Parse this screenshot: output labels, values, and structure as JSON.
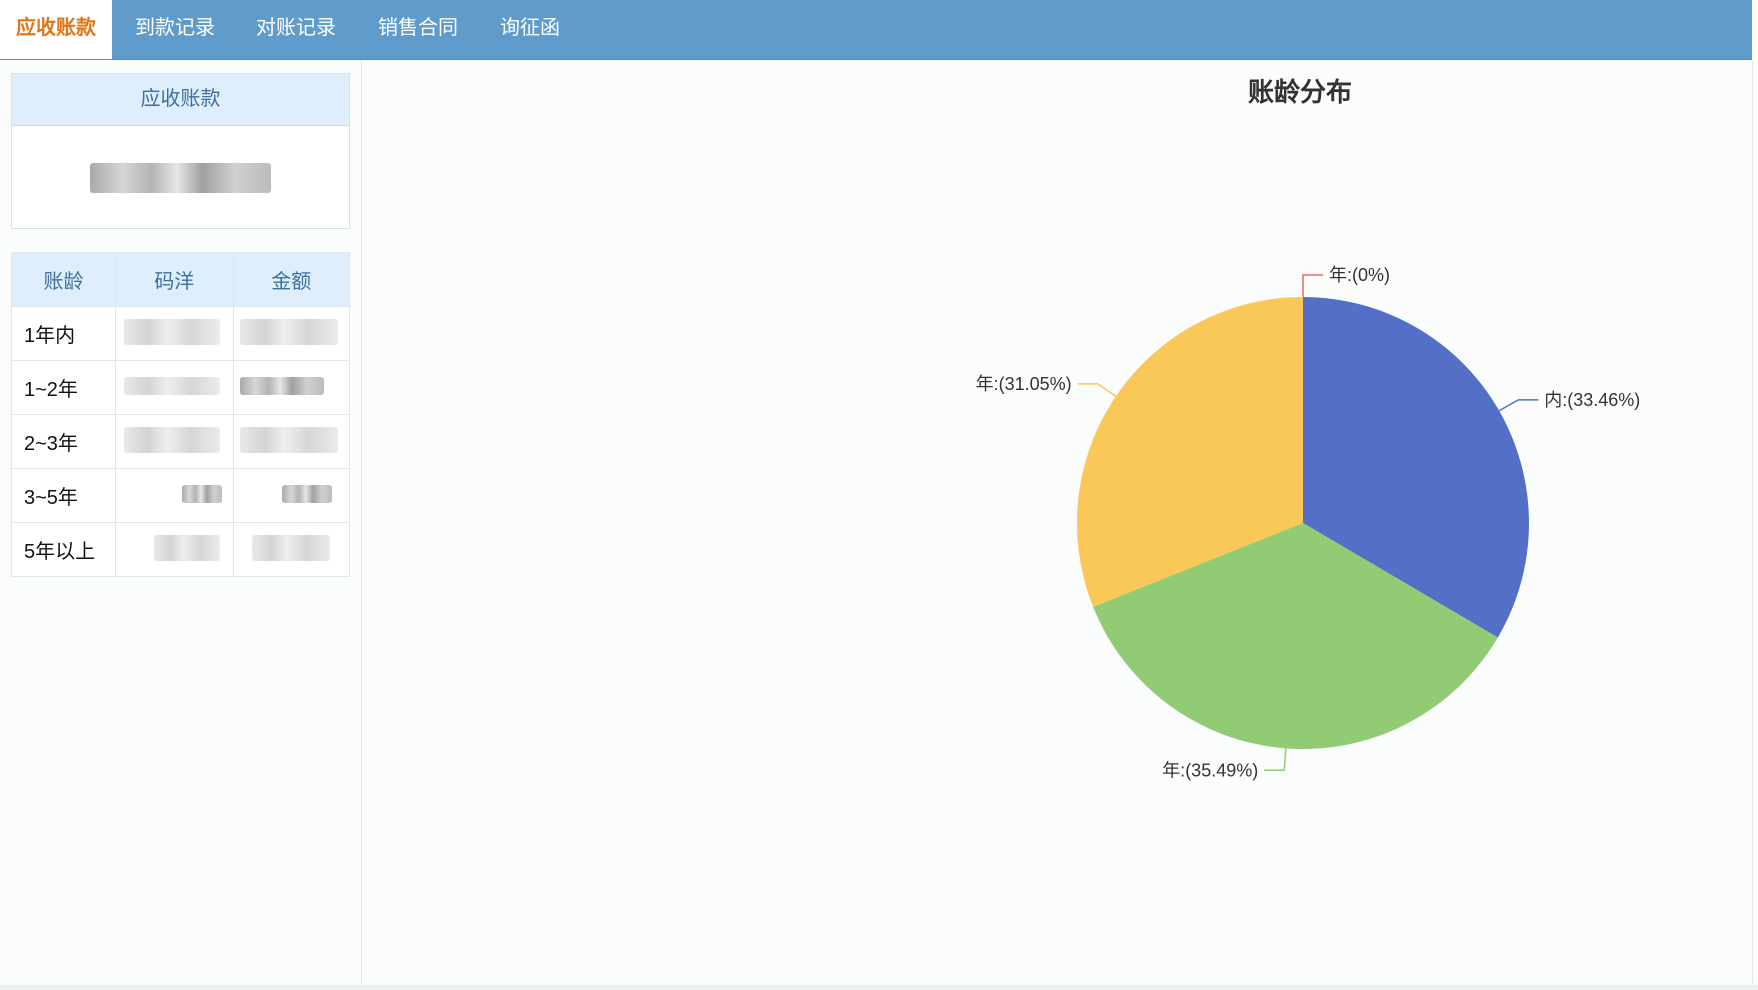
{
  "tabs": [
    {
      "label": "应收账款",
      "active": true
    },
    {
      "label": "到款记录",
      "active": false
    },
    {
      "label": "对账记录",
      "active": false
    },
    {
      "label": "销售合同",
      "active": false
    },
    {
      "label": "询征函",
      "active": false
    }
  ],
  "summary": {
    "title": "应收账款"
  },
  "aging_table": {
    "headers": [
      "账龄",
      "码洋",
      "金额"
    ],
    "rows": [
      {
        "age": "1年内"
      },
      {
        "age": "1~2年"
      },
      {
        "age": "2~3年"
      },
      {
        "age": "3~5年"
      },
      {
        "age": "5年以上"
      }
    ]
  },
  "chart_data": {
    "type": "pie",
    "title": "账龄分布",
    "slices": [
      {
        "label": "年:(0%)",
        "percent": 0,
        "color": "#ee6666"
      },
      {
        "label": "内:(33.46%)",
        "percent": 33.46,
        "color": "#5470c6"
      },
      {
        "label": "年:(35.49%)",
        "percent": 35.49,
        "color": "#91cc75"
      },
      {
        "label": "年:(31.05%)",
        "percent": 31.05,
        "color": "#fac858"
      }
    ]
  },
  "colors": {
    "tabbar": "#5f9ccc",
    "active_tab_text": "#e0761a",
    "table_header_bg": "#dfeefc",
    "table_header_text": "#3e6f9f"
  }
}
